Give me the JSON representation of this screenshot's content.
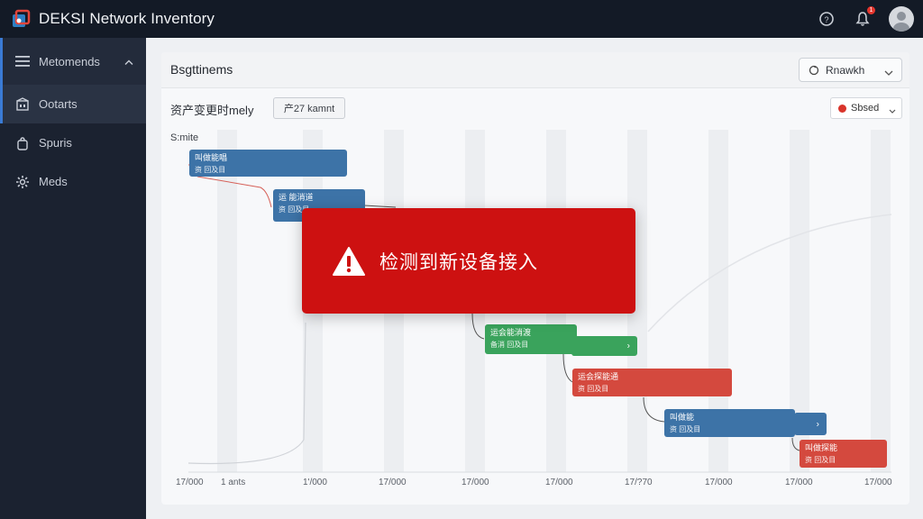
{
  "app": {
    "title": "DEKSI Network Inventory"
  },
  "header": {
    "notification_count": "1"
  },
  "sidebar": {
    "items": [
      {
        "label": "Metomends",
        "icon": "menu-icon",
        "state": "header"
      },
      {
        "label": "Ootarts",
        "icon": "building-icon",
        "state": "active"
      },
      {
        "label": "Spuris",
        "icon": "bag-icon",
        "state": "normal"
      },
      {
        "label": "Meds",
        "icon": "gear-icon",
        "state": "normal"
      }
    ]
  },
  "main": {
    "title": "Bsgttinems",
    "dropdown": {
      "value": "Rnawkh"
    },
    "subtitle": "资产变更时mely",
    "sub_button": "产27 kamnt",
    "status": {
      "label": "Sbsed",
      "color": "#d9342b"
    },
    "y_label": "S:mite",
    "x_ticks": [
      "17/000",
      "1 ants",
      "1'/000",
      "17/000",
      "17/000",
      "17/000",
      "17/?70",
      "17/000",
      "17/000",
      "17/000"
    ],
    "tasks": [
      {
        "title": "叫做能唱",
        "sub": "资 回及目",
        "color": "blue"
      },
      {
        "title": "运 能消道",
        "sub": "资 回及目",
        "color": "blue"
      },
      {
        "title": "运会能消渡",
        "sub": "备消 回及目",
        "color": "green"
      },
      {
        "title": "运会探能通",
        "sub": "资 回及目",
        "color": "red"
      },
      {
        "title": "叫做能",
        "sub": "资 回及目",
        "color": "blue"
      },
      {
        "title": "叫做探能",
        "sub": "资 回及目",
        "color": "red"
      }
    ]
  },
  "alert": {
    "message": "检测到新设备接入",
    "icon": "warning-icon"
  }
}
